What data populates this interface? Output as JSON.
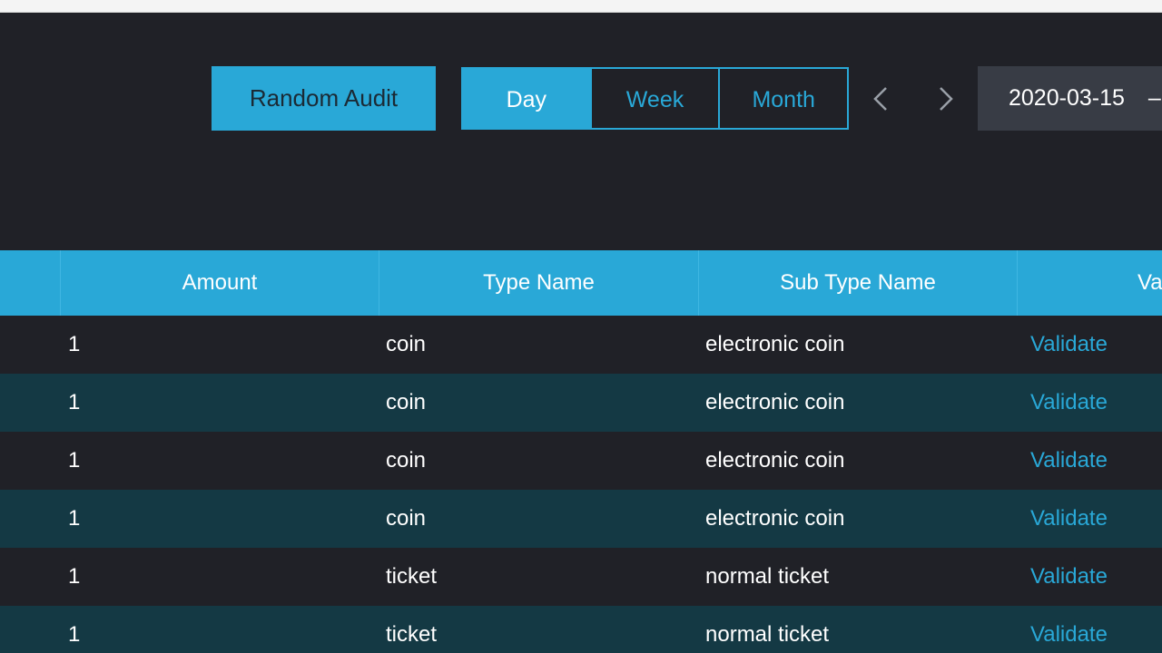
{
  "toolbar": {
    "random_audit_label": "Random Audit",
    "range_options": [
      "Day",
      "Week",
      "Month"
    ],
    "active_range": "Day",
    "date_value": "2020-03-15",
    "date_separator": "–"
  },
  "table": {
    "headers": [
      "",
      "Amount",
      "Type Name",
      "Sub Type Name",
      "Va"
    ],
    "rows": [
      {
        "amount": "1",
        "type_name": "coin",
        "sub_type_name": "electronic coin",
        "action": "Validate"
      },
      {
        "amount": "1",
        "type_name": "coin",
        "sub_type_name": "electronic coin",
        "action": "Validate"
      },
      {
        "amount": "1",
        "type_name": "coin",
        "sub_type_name": "electronic coin",
        "action": "Validate"
      },
      {
        "amount": "1",
        "type_name": "coin",
        "sub_type_name": "electronic coin",
        "action": "Validate"
      },
      {
        "amount": "1",
        "type_name": "ticket",
        "sub_type_name": "normal ticket",
        "action": "Validate"
      },
      {
        "amount": "1",
        "type_name": "ticket",
        "sub_type_name": "normal ticket",
        "action": "Validate"
      }
    ]
  },
  "colors": {
    "accent": "#29a8d7",
    "background": "#202127",
    "row_alt": "#143944",
    "date_box": "#383c45"
  },
  "icons": {
    "prev": "chevron-left-icon",
    "next": "chevron-right-icon"
  }
}
